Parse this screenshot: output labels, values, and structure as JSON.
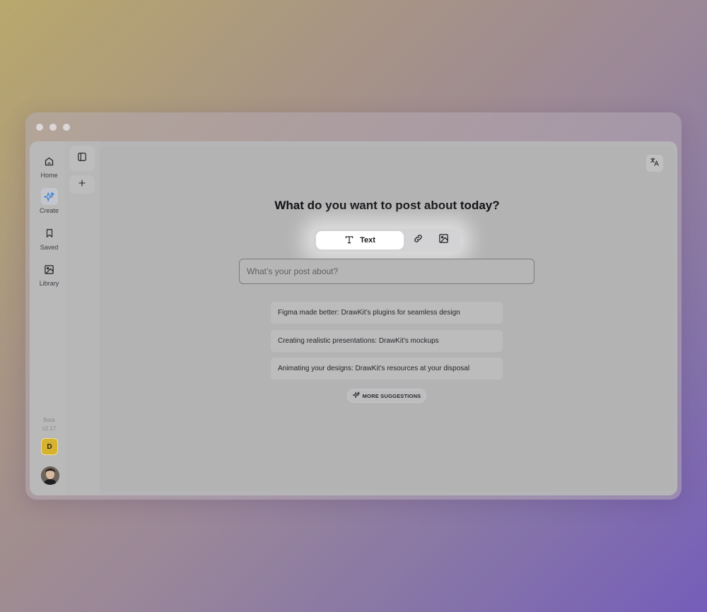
{
  "window": {
    "controls": [
      "close",
      "minimize",
      "maximize"
    ]
  },
  "sidebar": {
    "items": [
      {
        "label": "Home",
        "icon": "home-icon",
        "active": false
      },
      {
        "label": "Create",
        "icon": "sparkle-icon",
        "active": true,
        "accent": "#3a7fd0"
      },
      {
        "label": "Saved",
        "icon": "bookmark-icon",
        "active": false
      },
      {
        "label": "Library",
        "icon": "image-icon",
        "active": false
      }
    ],
    "beta_label": "Beta",
    "version": "v2.17",
    "workspace_initial": "D",
    "workspace_color": "#d5b22f"
  },
  "panel": {
    "toggle_icon": "sidebar-toggle-icon",
    "add_icon": "plus-icon"
  },
  "main": {
    "translate_icon": "translate-icon",
    "headline": "What do you want to post about today?",
    "modes": [
      {
        "label": "Text",
        "icon": "text-icon",
        "selected": true
      },
      {
        "label": "",
        "icon": "link-icon",
        "selected": false
      },
      {
        "label": "",
        "icon": "image-icon",
        "selected": false
      }
    ],
    "input": {
      "placeholder": "What’s your post about?",
      "value": ""
    },
    "suggestions": [
      "Figma made better: DrawKit’s plugins for seamless design",
      "Creating realistic presentations: DrawKit’s mockups",
      "Animating your designs: DrawKit’s resources at your disposal"
    ],
    "more_suggestions_label": "MORE SUGGESTIONS"
  }
}
